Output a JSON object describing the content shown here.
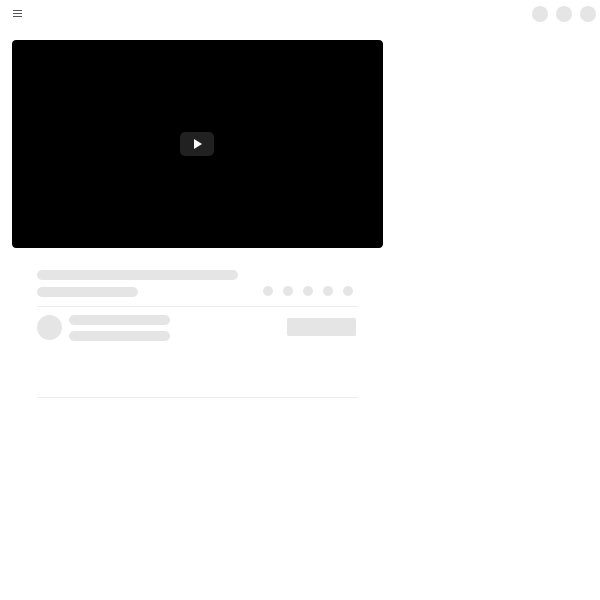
{
  "header": {
    "menu_icon": "hamburger-menu-icon",
    "actions": [
      "action-placeholder-1",
      "action-placeholder-2",
      "action-placeholder-3"
    ]
  },
  "player": {
    "play_icon": "play-icon",
    "background": "#000000"
  },
  "video_info": {
    "action_buttons": 5
  },
  "colors": {
    "skeleton": "#e5e5e5",
    "divider": "#ececec",
    "background": "#ffffff"
  }
}
